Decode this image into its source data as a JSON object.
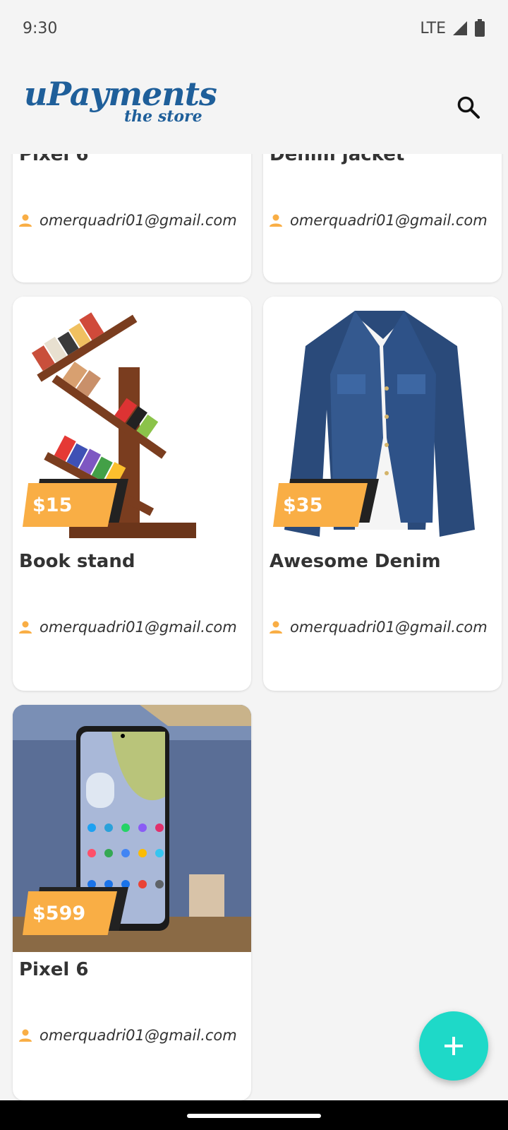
{
  "status_bar": {
    "time": "9:30",
    "network": "LTE"
  },
  "header": {
    "logo_main": "uPayments",
    "logo_sub": "the store",
    "search_icon": "search-icon"
  },
  "colors": {
    "accent": "#1ed9c8",
    "price_tag": "#f9ae45",
    "brand": "#1f5f9a"
  },
  "products_partial": [
    {
      "title": "Pixel 6",
      "owner": "omerquadri01@gmail.com"
    },
    {
      "title": "Denim jacket",
      "owner": "omerquadri01@gmail.com"
    }
  ],
  "products": [
    {
      "title": "Book stand",
      "price": "$15",
      "owner": "omerquadri01@gmail.com"
    },
    {
      "title": "Awesome Denim",
      "price": "$35",
      "owner": "omerquadri01@gmail.com"
    },
    {
      "title": "Pixel 6",
      "price": "$599",
      "owner": "omerquadri01@gmail.com"
    }
  ],
  "fab": {
    "icon": "plus-icon"
  }
}
